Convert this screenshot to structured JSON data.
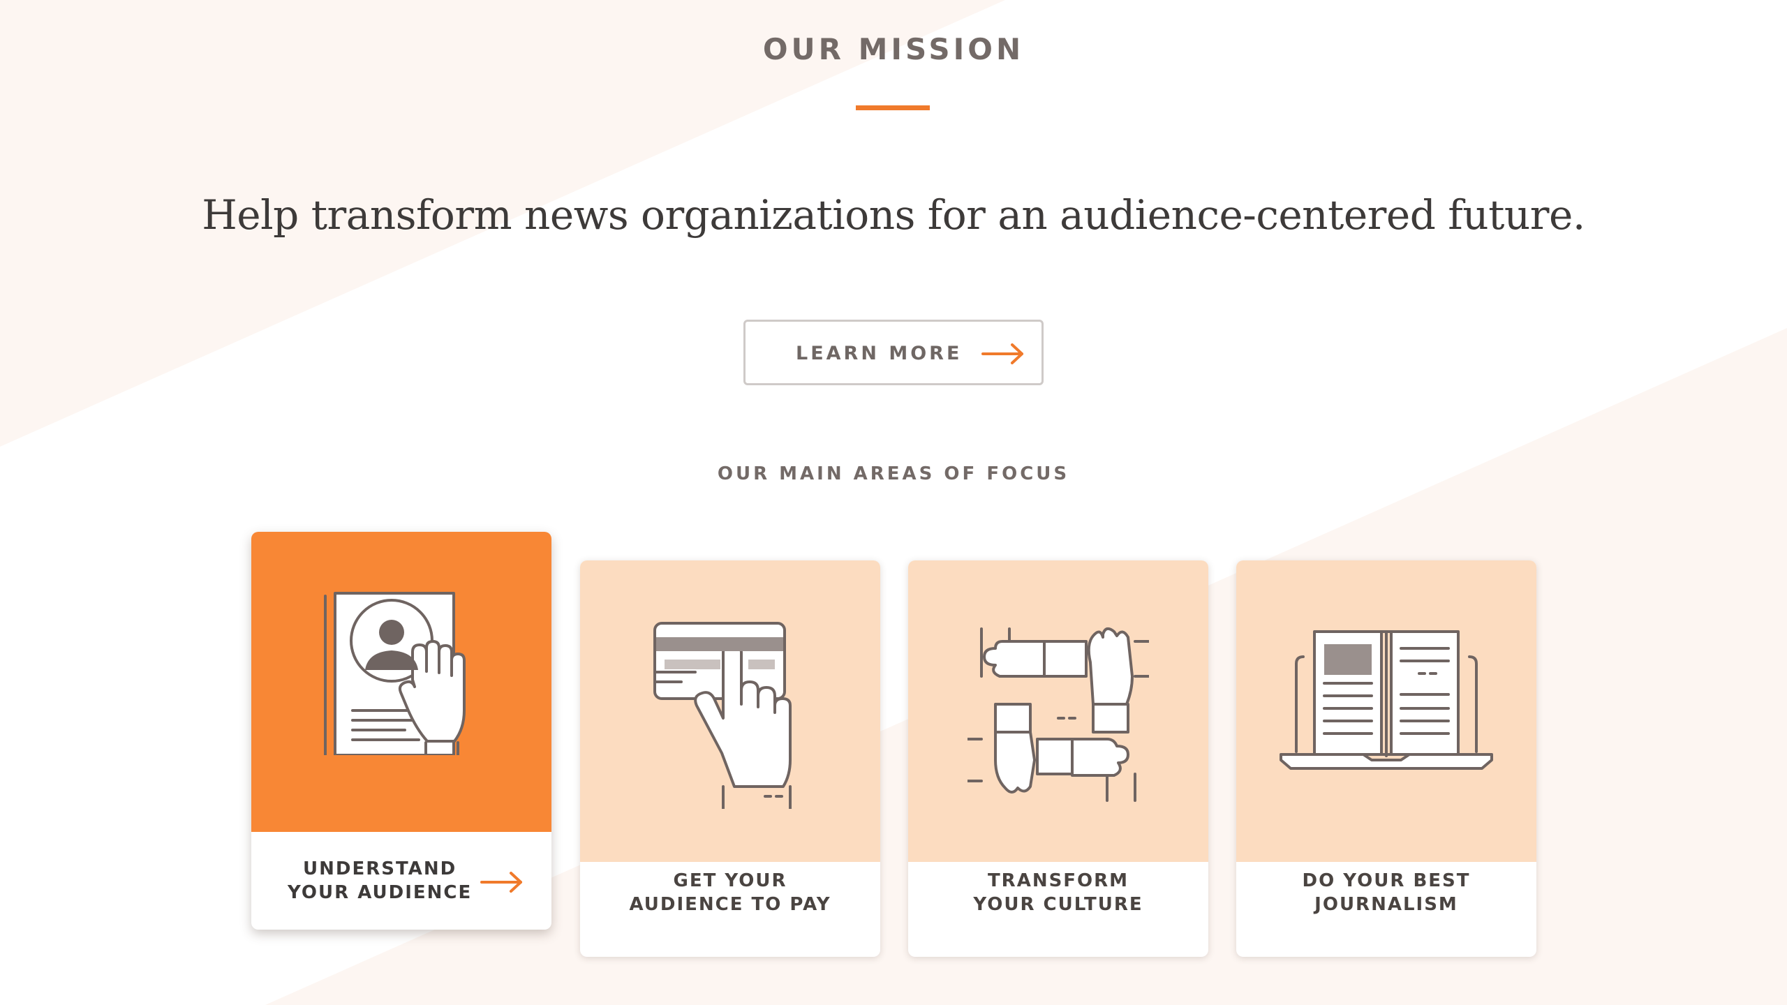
{
  "mission": {
    "title": "OUR MISSION",
    "statement": "Help transform news organizations for an audience-centered future.",
    "learn_more_label": "LEARN MORE"
  },
  "focus": {
    "heading": "OUR MAIN AREAS OF FOCUS",
    "cards": [
      {
        "label": "UNDERSTAND\nYOUR AUDIENCE",
        "icon": "audience-profile-icon",
        "active": true
      },
      {
        "label": "GET YOUR\nAUDIENCE TO PAY",
        "icon": "credit-card-tap-icon",
        "active": false
      },
      {
        "label": "TRANSFORM\nYOUR CULTURE",
        "icon": "interlocking-hands-icon",
        "active": false
      },
      {
        "label": "DO YOUR BEST\nJOURNALISM",
        "icon": "open-book-laptop-icon",
        "active": false
      }
    ]
  },
  "colors": {
    "accent": "#f07a2b",
    "active_card": "#f88735",
    "card_art": "#fcdcc0",
    "background_tint": "#fdf6f2",
    "heading_text": "#736a67",
    "body_text": "#3d3a39"
  }
}
